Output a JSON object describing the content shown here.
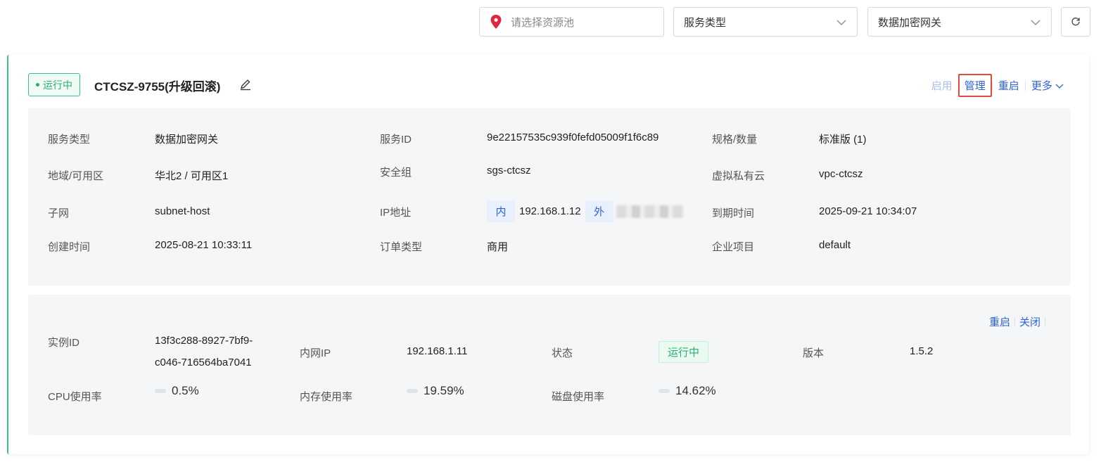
{
  "filters": {
    "pool_placeholder": "请选择资源池",
    "service_type": "服务类型",
    "product": "数据加密网关"
  },
  "card": {
    "status": "运行中",
    "title": "CTCSZ-9755(升级回滚)",
    "actions": {
      "enable": "启用",
      "manage": "管理",
      "restart": "重启",
      "more": "更多"
    }
  },
  "info": {
    "service_type_label": "服务类型",
    "service_type_value": "数据加密网关",
    "service_id_label": "服务ID",
    "service_id_value": "9e22157535c939f0fefd05009f1f6c89",
    "spec_label": "规格/数量",
    "spec_value": "标准版 (1)",
    "region_label": "地域/可用区",
    "region_value": "华北2 / 可用区1",
    "sg_label": "安全组",
    "sg_value": "sgs-ctcsz",
    "vpc_label": "虚拟私有云",
    "vpc_value": "vpc-ctcsz",
    "subnet_label": "子网",
    "subnet_value": "subnet-host",
    "ip_label": "IP地址",
    "ip_inner_tag": "内",
    "ip_inner_value": "192.168.1.12",
    "ip_outer_tag": "外",
    "expire_label": "到期时间",
    "expire_value": "2025-09-21 10:34:07",
    "created_label": "创建时间",
    "created_value": "2025-08-21 10:33:11",
    "order_label": "订单类型",
    "order_value": "商用",
    "project_label": "企业项目",
    "project_value": "default"
  },
  "instance": {
    "actions": {
      "restart": "重启",
      "close": "关闭"
    },
    "id_label": "实例ID",
    "id_line1": "13f3c288-8927-7bf9-",
    "id_line2": "c046-716564ba7041",
    "ip_label": "内网IP",
    "ip_value": "192.168.1.11",
    "status_label": "状态",
    "status_value": "运行中",
    "version_label": "版本",
    "version_value": "1.5.2",
    "cpu_label": "CPU使用率",
    "cpu_value": "0.5%",
    "cpu_fraction": 0.005,
    "mem_label": "内存使用率",
    "mem_value": "19.59%",
    "mem_fraction": 0.1959,
    "disk_label": "磁盘使用率",
    "disk_value": "14.62%",
    "disk_fraction": 0.1462
  },
  "colors": {
    "accent": "#2f62d3",
    "success": "#27b072",
    "highlight_border": "#e04a3f",
    "location_pin": "#e0263d"
  }
}
